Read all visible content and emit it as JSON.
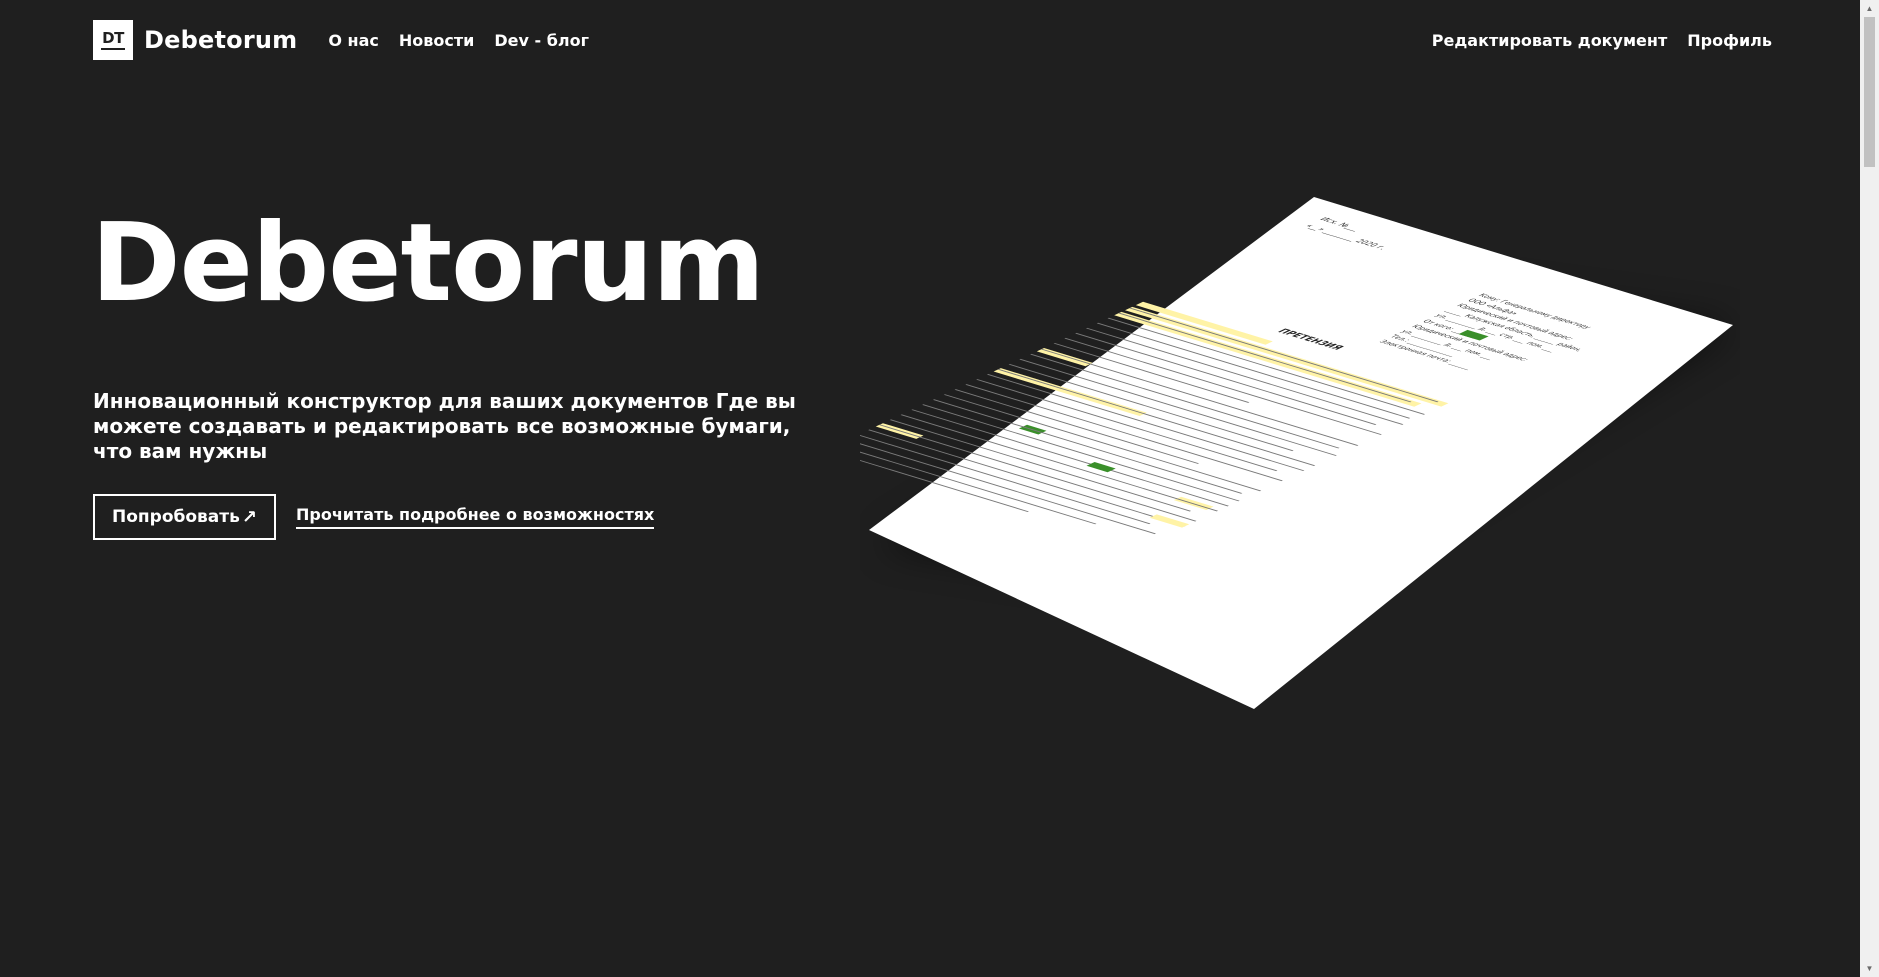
{
  "header": {
    "logo_mark": "DT",
    "logo_text": "Debetorum",
    "nav": [
      {
        "label": "О нас"
      },
      {
        "label": "Новости"
      },
      {
        "label": "Dev - блог"
      }
    ],
    "right_links": [
      {
        "label": "Редактировать документ"
      },
      {
        "label": "Профиль"
      }
    ]
  },
  "hero": {
    "title": "Debetorum",
    "subtitle": "Инновационный конструктор для ваших документов Где вы можете создавать и редактировать все возможные бумаги, что вам нужны",
    "try_button": "Попробовать",
    "try_button_icon": "↗",
    "more_link": "Прочитать подробнее о возможностях"
  },
  "document": {
    "heading": "ПРЕТЕНЗИЯ",
    "number_line": "Исх. №___",
    "date_line": "«__» ________ 2020 г.",
    "addressee": [
      "Кому: Генеральному директору",
      "ООО «Альфа»",
      "Юридический и почтовый адрес:",
      "_____ Калужская область, ______ район,",
      "ул. _________ д. ___ стр. ___ пом. ___",
      "От кого: _______",
      "Юридический и почтовый адрес:",
      "ул. _________ д. ___ пом. ___",
      "Тел.: ______________",
      "Электронная почта: ______"
    ]
  },
  "colors": {
    "background": "#1f1f1f",
    "text": "#ffffff",
    "paper": "#ffffff",
    "highlight_yellow": "#fff3a6",
    "highlight_green": "#3a8f2a"
  }
}
